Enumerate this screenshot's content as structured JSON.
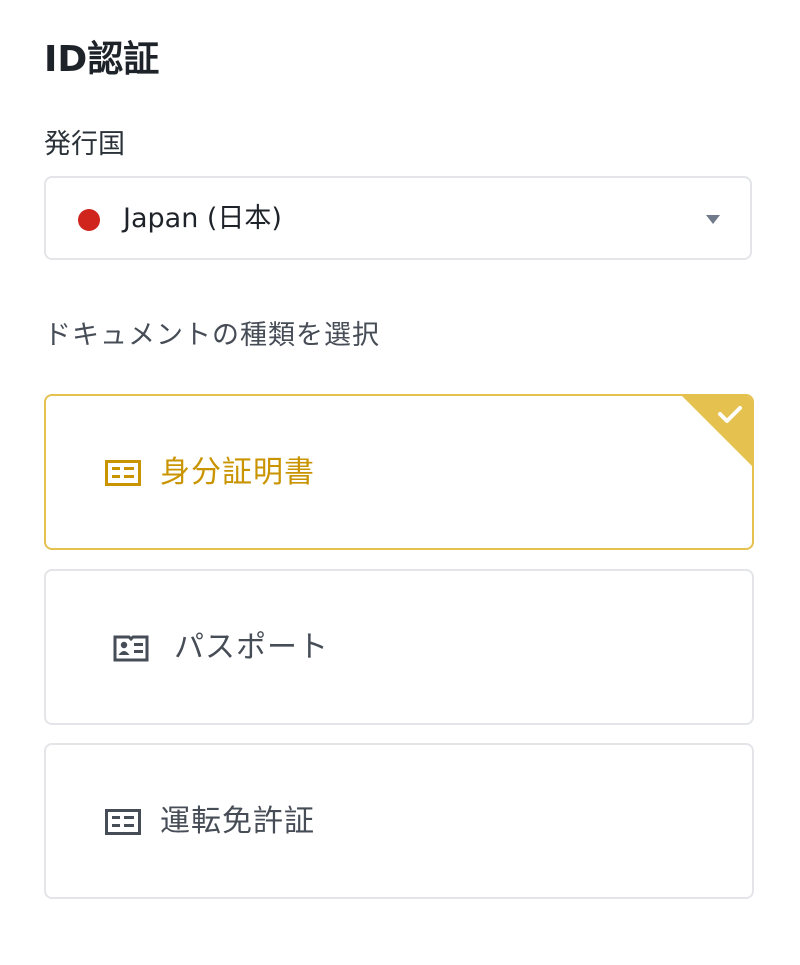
{
  "page": {
    "title": "ID認証"
  },
  "issuing_country": {
    "label": "発行国",
    "selected_value": "Japan (日本)",
    "flag_color": "#d0251d",
    "dropdown_icon": "caret-down-icon"
  },
  "document_type": {
    "label": "ドキュメントの種類を選択",
    "accent_color": "#e5c14f",
    "options": [
      {
        "label": "身分証明書",
        "icon": "id-card-icon",
        "selected": true
      },
      {
        "label": "パスポート",
        "icon": "passport-icon",
        "selected": false
      },
      {
        "label": "運転免許証",
        "icon": "id-card-icon",
        "selected": false
      }
    ]
  }
}
